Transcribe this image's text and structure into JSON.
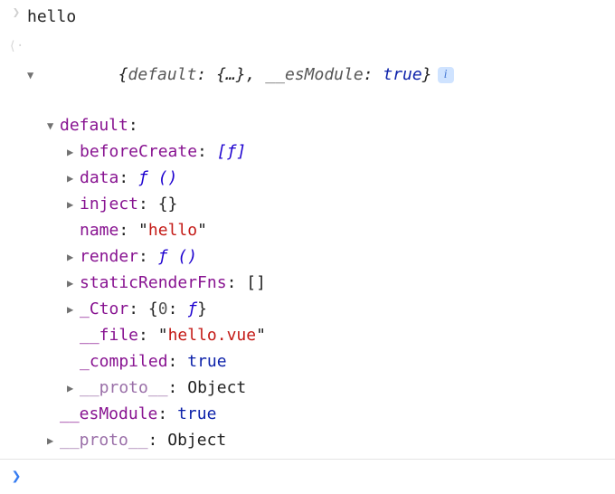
{
  "input": {
    "expr": "hello"
  },
  "summary": {
    "open": "{",
    "k1": "default",
    "v1": "{…}",
    "sep": ", ",
    "k2": "__esModule",
    "v2": "true",
    "close": "}",
    "info": "i"
  },
  "tree": {
    "default_label": "default",
    "beforeCreate": {
      "k": "beforeCreate",
      "v": "[ƒ]"
    },
    "data": {
      "k": "data",
      "fn": "ƒ ()",
      "v_open": "",
      "v_close": ""
    },
    "inject": {
      "k": "inject",
      "v": "{}"
    },
    "name": {
      "k": "name",
      "q1": "\"",
      "v": "hello",
      "q2": "\""
    },
    "render": {
      "k": "render",
      "fn": "ƒ ()"
    },
    "staticRenderFns": {
      "k": "staticRenderFns",
      "v": "[]"
    },
    "ctor": {
      "k": "_Ctor",
      "open": "{",
      "ik": "0",
      "iv": "ƒ",
      "close": "}"
    },
    "file": {
      "k": "__file",
      "q1": "\"",
      "v": "hello.vue",
      "q2": "\""
    },
    "compiled": {
      "k": "_compiled",
      "v": "true"
    },
    "proto1": {
      "k": "__proto__",
      "v": "Object"
    },
    "esModule": {
      "k": "__esModule",
      "v": "true"
    },
    "proto2": {
      "k": "__proto__",
      "v": "Object"
    }
  },
  "colon": ":",
  "space": " "
}
